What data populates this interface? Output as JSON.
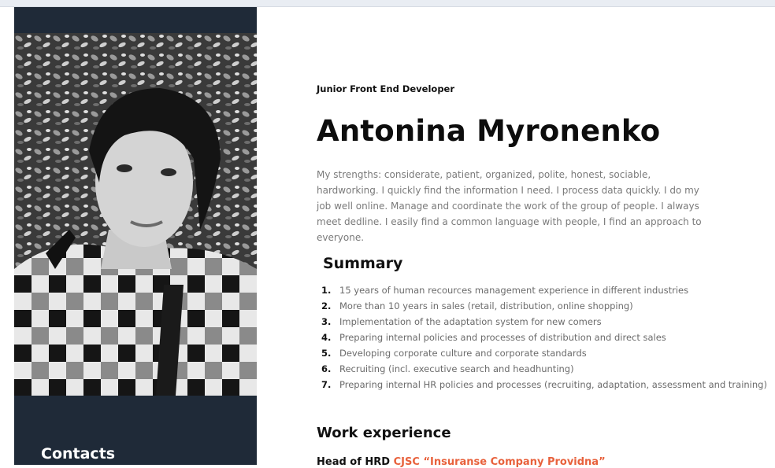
{
  "sidebar": {
    "photo_alt": "Portrait photo",
    "contacts_title": "Contacts"
  },
  "main": {
    "job_title": "Junior Front End Developer",
    "name": "Antonina Myronenko",
    "strengths": "My strengths: considerate, patient, organized, polite, honest, sociable, hardworking. I quickly find the information I need. I process data quickly. I do my job well online. Manage and coordinate the work of the group of people. I always meet dedline. I easily find a common language with people, I find an approach to everyone.",
    "summary": {
      "title": "Summary",
      "items": [
        {
          "num": "1.",
          "text": "15 years of human recources management experience in different industries"
        },
        {
          "num": "2.",
          "text": "More than 10 years in sales (retail, distribution, online shopping)"
        },
        {
          "num": "3.",
          "text": "Implementation of the adaptation system for new comers"
        },
        {
          "num": "4.",
          "text": "Preparing internal policies and processes of distribution and direct sales"
        },
        {
          "num": "5.",
          "text": "Developing corporate culture and corporate standards"
        },
        {
          "num": "6.",
          "text": "Recruiting (incl. executive search and headhunting)"
        },
        {
          "num": "7.",
          "text": "Preparing internal HR policies and processes (recruiting, adaptation, assessment and training)"
        }
      ]
    },
    "work": {
      "title": "Work experience",
      "first_role": "Head of HRD",
      "first_company": "CJSC “Insuranse Company Providna”"
    }
  },
  "colors": {
    "sidebar_bg": "#1f2a38",
    "accent": "#e8613c",
    "muted_text": "#7a7a7a"
  }
}
